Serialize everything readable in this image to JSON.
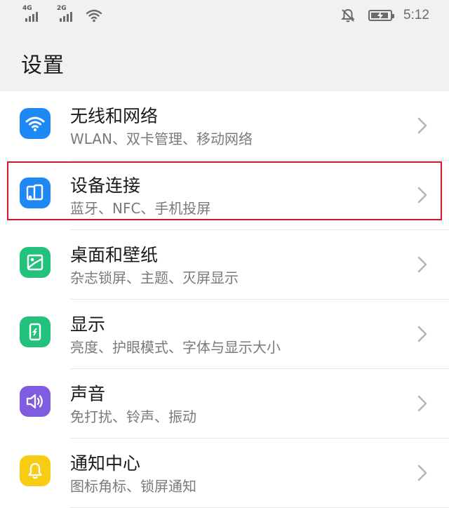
{
  "status_bar": {
    "network1": "4G",
    "network2": "2G",
    "time": "5:12",
    "icons": [
      "signal-icon",
      "signal-icon",
      "wifi-icon",
      "bell-muted-icon",
      "battery-charging-icon"
    ]
  },
  "header": {
    "title": "设置"
  },
  "colors": {
    "wifi": "#1e88f5",
    "device": "#1e88f5",
    "desktop": "#22c17c",
    "display": "#22c17c",
    "sound": "#7f5ce0",
    "notification": "#f7cc12",
    "highlight": "#d51a22"
  },
  "settings": {
    "items": [
      {
        "title": "无线和网络",
        "subtitle": "WLAN、双卡管理、移动网络",
        "icon": "wifi-icon"
      },
      {
        "title": "设备连接",
        "subtitle": "蓝牙、NFC、手机投屏",
        "icon": "device-connection-icon"
      },
      {
        "title": "桌面和壁纸",
        "subtitle": "杂志锁屏、主题、灭屏显示",
        "icon": "wallpaper-icon"
      },
      {
        "title": "显示",
        "subtitle": "亮度、护眼模式、字体与显示大小",
        "icon": "display-icon"
      },
      {
        "title": "声音",
        "subtitle": "免打扰、铃声、振动",
        "icon": "speaker-icon"
      },
      {
        "title": "通知中心",
        "subtitle": "图标角标、锁屏通知",
        "icon": "bell-icon"
      }
    ]
  }
}
